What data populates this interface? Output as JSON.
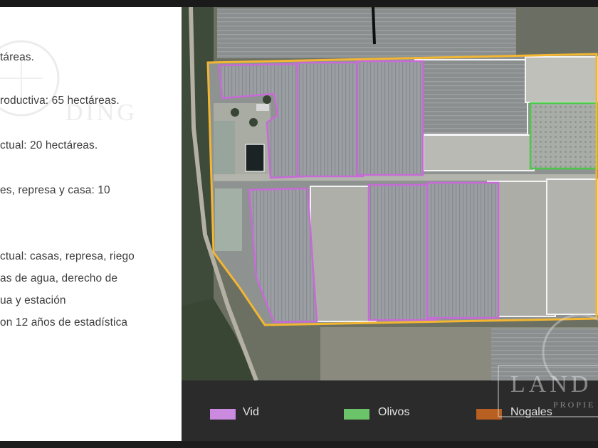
{
  "description": {
    "lines": [
      "táreas.",
      "roductiva: 65 hectáreas.",
      "ctual: 20 hectáreas.",
      "es, represa y casa: 10",
      "ctual: casas, represa, riego",
      "as de agua, derecho de",
      "ua y estación",
      "on 12 años de estadística"
    ]
  },
  "legend": {
    "items": [
      {
        "label": "Vid",
        "color": "#c98ae0"
      },
      {
        "label": "Olivos",
        "color": "#6cc46a"
      },
      {
        "label": "Nogales",
        "color": "#b85f22"
      }
    ]
  },
  "map": {
    "boundary_color": "#f2b632",
    "vid_color": "#c86ad8",
    "olivos_color": "#4cc94a",
    "free_parcel_color": "#f4f4f4"
  },
  "watermark": {
    "left_text": "DING",
    "right_text": "LAND",
    "right_subtext": "PROPIE"
  }
}
